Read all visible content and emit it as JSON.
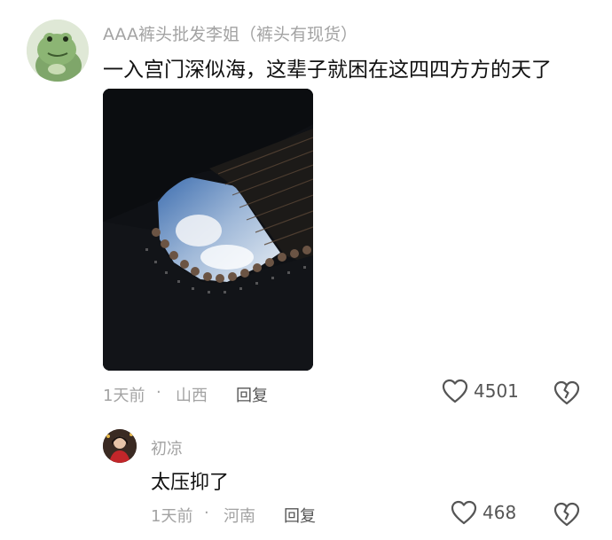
{
  "comment": {
    "username": "AAA裤头批发李姐（裤头有现货）",
    "text": "一入宫门深似海，这辈子就困在这四四方方的天了",
    "time": "1天前",
    "separator": "·",
    "location": "山西",
    "reply_label": "回复",
    "like_count": "4501",
    "avatar_icon": "frog-avatar-icon",
    "photo_subject": "palace-courtyard-sky-photo"
  },
  "reply": {
    "username": "初凉",
    "text": "太压抑了",
    "time": "1天前",
    "separator": "·",
    "location": "河南",
    "reply_label": "回复",
    "like_count": "468"
  },
  "icons": {
    "like": "heart-icon",
    "dislike": "broken-heart-icon"
  },
  "colors": {
    "meta_text": "#a3a3a3",
    "body_text": "#111111",
    "icon": "#555555"
  }
}
